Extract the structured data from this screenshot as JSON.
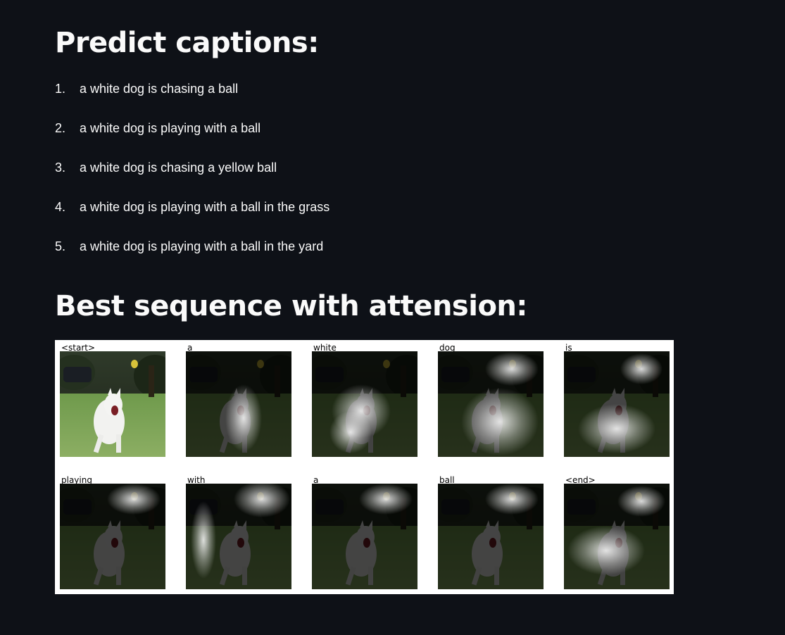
{
  "sections": {
    "predict_title": "Predict captions:",
    "attention_title": "Best sequence with attension:"
  },
  "captions": [
    "a white dog is chasing a ball",
    "a white dog is playing with a ball",
    "a white dog is chasing a yellow ball",
    "a white dog is playing with a ball in the grass",
    "a white dog is playing with a ball in the yard"
  ],
  "attention_frames": [
    {
      "token": "<start>",
      "original": true
    },
    {
      "token": "a",
      "focus": "dog-body"
    },
    {
      "token": "white",
      "focus": "dog-lower"
    },
    {
      "token": "dog",
      "focus": "dog-wide"
    },
    {
      "token": "is",
      "focus": "dog-ground"
    },
    {
      "token": "playing",
      "focus": "ball"
    },
    {
      "token": "with",
      "focus": "ball-left"
    },
    {
      "token": "a",
      "focus": "ball"
    },
    {
      "token": "ball",
      "focus": "ball"
    },
    {
      "token": "<end>",
      "focus": "ball-ground"
    }
  ],
  "colors": {
    "background": "#0e1117",
    "text": "#fafafa",
    "figure_bg": "#ffffff"
  }
}
